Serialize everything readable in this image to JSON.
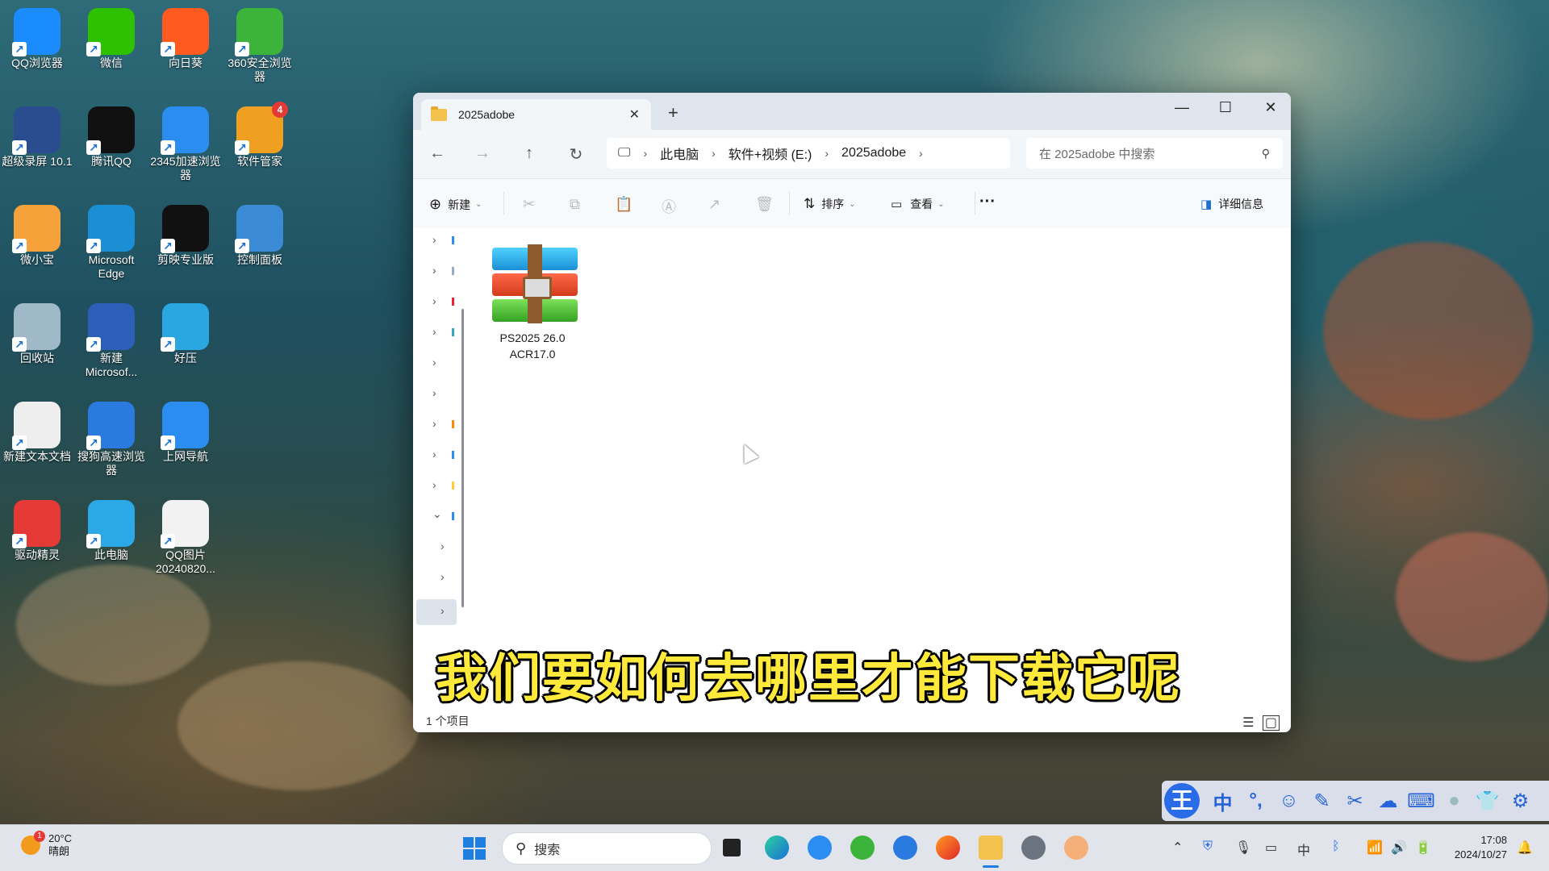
{
  "desktop": {
    "icons": [
      {
        "label": "QQ浏览器",
        "color": "#1a8cff"
      },
      {
        "label": "微信",
        "color": "#2dc100"
      },
      {
        "label": "向日葵",
        "color": "#ff5a1f"
      },
      {
        "label": "360安全浏览器",
        "color": "#3cb43c"
      },
      {
        "label": "超级录屏 10.1",
        "color": "#2a4d8f"
      },
      {
        "label": "腾讯QQ",
        "color": "#111111"
      },
      {
        "label": "2345加速浏览器",
        "color": "#2b8df0"
      },
      {
        "label": "软件管家",
        "color": "#f0a020",
        "badge": "4"
      },
      {
        "label": "微小宝",
        "color": "#f6a13a"
      },
      {
        "label": "Microsoft Edge",
        "color": "#1b8fd6"
      },
      {
        "label": "剪映专业版",
        "color": "#111111"
      },
      {
        "label": "控制面板",
        "color": "#3a8ad6"
      },
      {
        "label": "回收站",
        "color": "#9fb9c9"
      },
      {
        "label": "新建 Microsof...",
        "color": "#2b5fb8"
      },
      {
        "label": "好压",
        "color": "#2aa7e0"
      },
      {
        "label": "新建文本文档",
        "color": "#eeeeee"
      },
      {
        "label": "搜狗高速浏览器",
        "color": "#2a7ae0"
      },
      {
        "label": "上网导航",
        "color": "#2b8df0"
      },
      {
        "label": "驱动精灵",
        "color": "#e53935"
      },
      {
        "label": "此电脑",
        "color": "#2ba9e6"
      },
      {
        "label": "QQ图片 20240820...",
        "color": "#f2f2f2"
      }
    ]
  },
  "explorer": {
    "tab_title": "2025adobe",
    "breadcrumb": [
      "此电脑",
      "软件+视频 (E:)",
      "2025adobe"
    ],
    "search_placeholder": "在 2025adobe 中搜索",
    "toolbar": {
      "new_label": "新建",
      "sort_label": "排序",
      "view_label": "查看",
      "more_label": "···",
      "details_label": "详细信息"
    },
    "files": [
      {
        "name_line1": "PS2025 26.0",
        "name_line2": "ACR17.0",
        "type": "rar-archive"
      }
    ],
    "status_text": "1 个项目"
  },
  "subtitle": "我们要如何去哪里才能下载它呢",
  "ime": {
    "logo": "王",
    "mode": "中"
  },
  "taskbar": {
    "weather_temp": "20°C",
    "weather_desc": "晴朗",
    "weather_badge": "1",
    "search_label": "搜索",
    "time": "17:08",
    "date": "2024/10/27"
  }
}
